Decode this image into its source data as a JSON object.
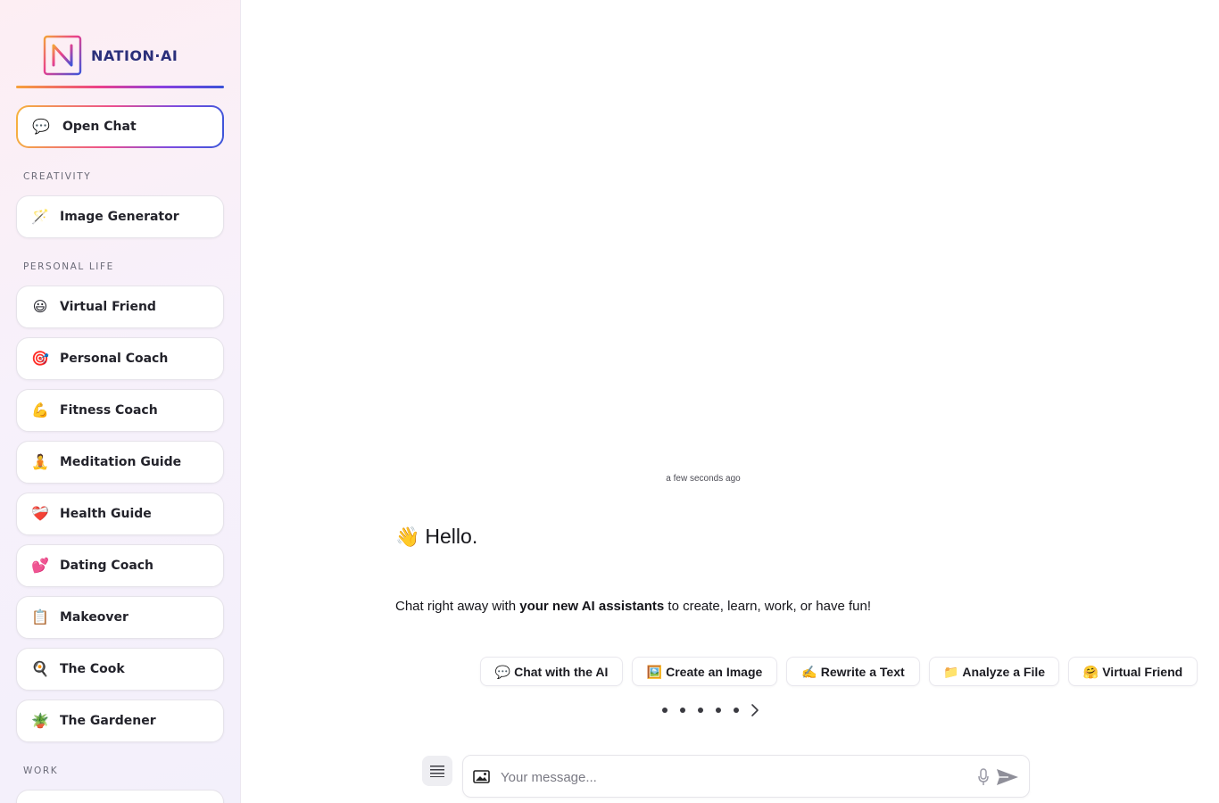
{
  "brand": {
    "name": "NATION·AI",
    "logo_letter": "N"
  },
  "sidebar": {
    "open_chat": {
      "label": "Open Chat",
      "icon": "speech-bubble-icon",
      "emoji": "💬"
    },
    "sections": [
      {
        "label": "CREATIVITY"
      },
      {
        "label": "PERSONAL LIFE"
      },
      {
        "label": "WORK"
      }
    ],
    "items": [
      {
        "label": "Image Generator",
        "emoji": "🪄",
        "icon": "magic-wand-icon"
      },
      {
        "label": "Virtual Friend",
        "emoji": "😃",
        "icon": "smiley-icon"
      },
      {
        "label": "Personal Coach",
        "emoji": "🎯",
        "icon": "target-icon"
      },
      {
        "label": "Fitness Coach",
        "emoji": "💪",
        "icon": "flexed-bicep-icon"
      },
      {
        "label": "Meditation Guide",
        "emoji": "🧘",
        "icon": "meditation-icon"
      },
      {
        "label": "Health Guide",
        "emoji": "❤️‍🩹",
        "icon": "mending-heart-icon"
      },
      {
        "label": "Dating Coach",
        "emoji": "💕",
        "icon": "two-hearts-icon"
      },
      {
        "label": "Makeover",
        "emoji": "📋",
        "icon": "clipboard-icon"
      },
      {
        "label": "The Cook",
        "emoji": "🍳",
        "icon": "frying-pan-icon"
      },
      {
        "label": "The Gardener",
        "emoji": "🪴",
        "icon": "potted-plant-icon"
      },
      {
        "label": "",
        "emoji": "",
        "icon": ""
      }
    ]
  },
  "chat": {
    "timestamp": "a few seconds ago",
    "greeting_emoji": "👋",
    "greeting": "Hello.",
    "intro_before": "Chat right away with ",
    "intro_bold": "your new AI assistants",
    "intro_after": " to create, learn, work, or have fun!"
  },
  "suggestions": [
    {
      "label": "Chat with the AI",
      "emoji": "💬",
      "icon": "speech-bubble-icon"
    },
    {
      "label": "Create an Image",
      "emoji": "🖼️",
      "icon": "framed-picture-icon"
    },
    {
      "label": "Rewrite a Text",
      "emoji": "✍️",
      "icon": "writing-hand-icon"
    },
    {
      "label": "Analyze a File",
      "emoji": "📁",
      "icon": "folder-icon"
    },
    {
      "label": "Virtual Friend",
      "emoji": "🤗",
      "icon": "hugging-face-icon"
    }
  ],
  "composer": {
    "placeholder": "Your message..."
  },
  "colors": {
    "brand_navy": "#2a2f7a",
    "gradient": [
      "#f6a23a",
      "#ec3f8a",
      "#8a3fe0",
      "#3a52d8"
    ]
  }
}
